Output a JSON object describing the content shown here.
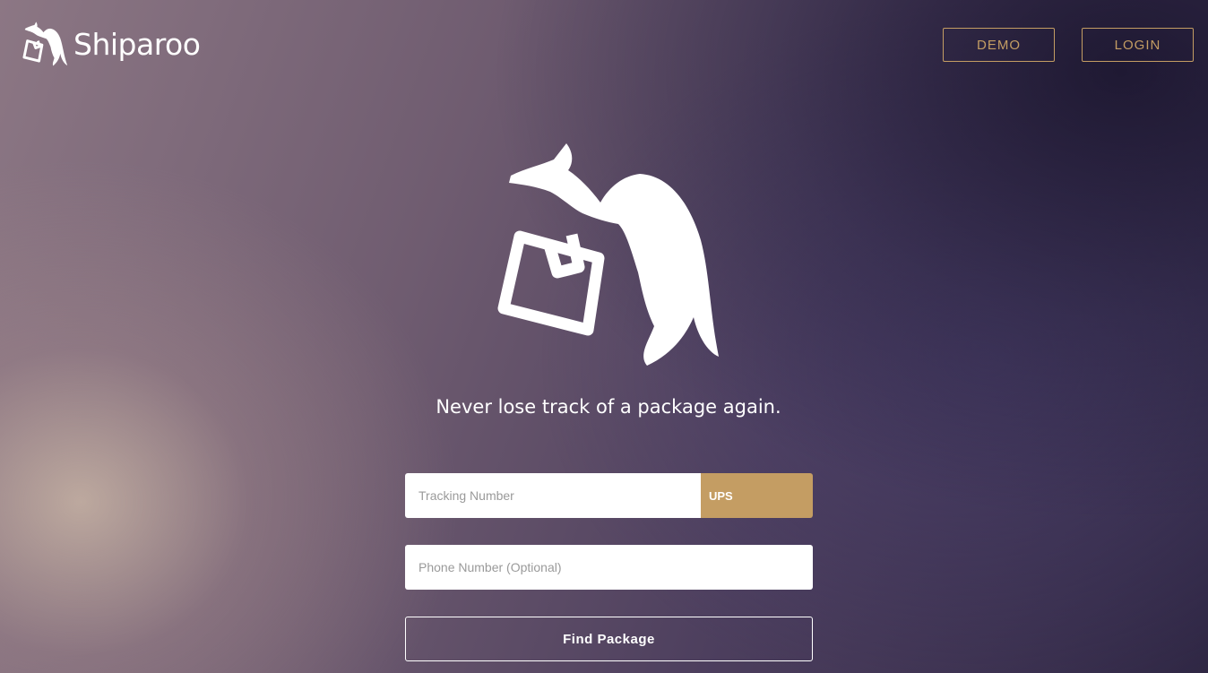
{
  "header": {
    "brand_name": "Shiparoo",
    "logo_icon": "kangaroo-package-icon",
    "demo_label": "DEMO",
    "login_label": "LOGIN"
  },
  "hero": {
    "illustration_icon": "kangaroo-package-icon",
    "tagline": "Never lose track of a package again."
  },
  "form": {
    "tracking_placeholder": "Tracking Number",
    "tracking_value": "",
    "carrier_selected": "UPS",
    "phone_placeholder": "Phone Number (Optional)",
    "phone_value": "",
    "submit_label": "Find Package"
  },
  "colors": {
    "accent": "#c49d63",
    "text": "#ffffff",
    "input_bg": "#ffffff"
  }
}
